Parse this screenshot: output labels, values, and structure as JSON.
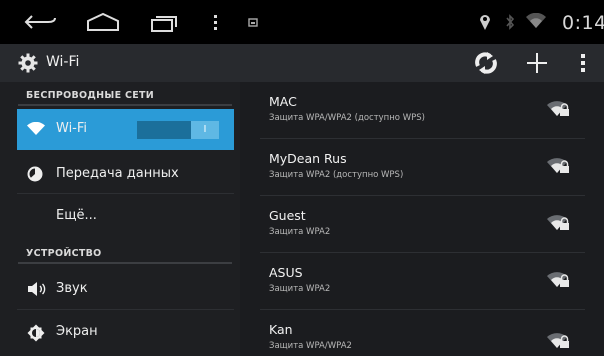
{
  "status_bar": {
    "time": "0:14",
    "icons": [
      "back-icon",
      "home-icon",
      "recents-icon",
      "overflow-icon",
      "notification-icon",
      "location-icon",
      "bluetooth-icon",
      "wifi-icon"
    ]
  },
  "action_bar": {
    "title": "Wi-Fi",
    "icons": [
      "settings-gear-icon",
      "wps-scan-icon",
      "add-icon",
      "overflow-menu-icon"
    ]
  },
  "sidebar": {
    "section_wireless": "БЕСПРОВОДНЫЕ СЕТИ",
    "section_device": "УСТРОЙСТВО",
    "items": [
      {
        "label": "Wi-Fi",
        "icon": "wifi-icon",
        "selected": true,
        "toggle": "I"
      },
      {
        "label": "Передача данных",
        "icon": "data-usage-icon"
      },
      {
        "label": "Ещё..."
      },
      {
        "label": "Звук",
        "icon": "sound-icon"
      },
      {
        "label": "Экран",
        "icon": "display-icon"
      }
    ]
  },
  "networks": [
    {
      "name": "MAC",
      "security": "Защита WPA/WPA2 (доступно WPS)",
      "icon": "wifi-locked-icon"
    },
    {
      "name": "MyDean Rus",
      "security": "Защита WPA2 (доступно WPS)",
      "icon": "wifi-locked-icon"
    },
    {
      "name": "Guest",
      "security": "Защита WPA2",
      "icon": "wifi-locked-icon"
    },
    {
      "name": "ASUS",
      "security": "Защита WPA2",
      "icon": "wifi-locked-icon"
    },
    {
      "name": "Kan",
      "security": "Защита WPA/WPA2",
      "icon": "wifi-locked-icon"
    }
  ],
  "colors": {
    "accent": "#2b9bd7",
    "background": "#1b1c1f",
    "status_bar": "#000000",
    "action_bar": "#282a2e"
  }
}
